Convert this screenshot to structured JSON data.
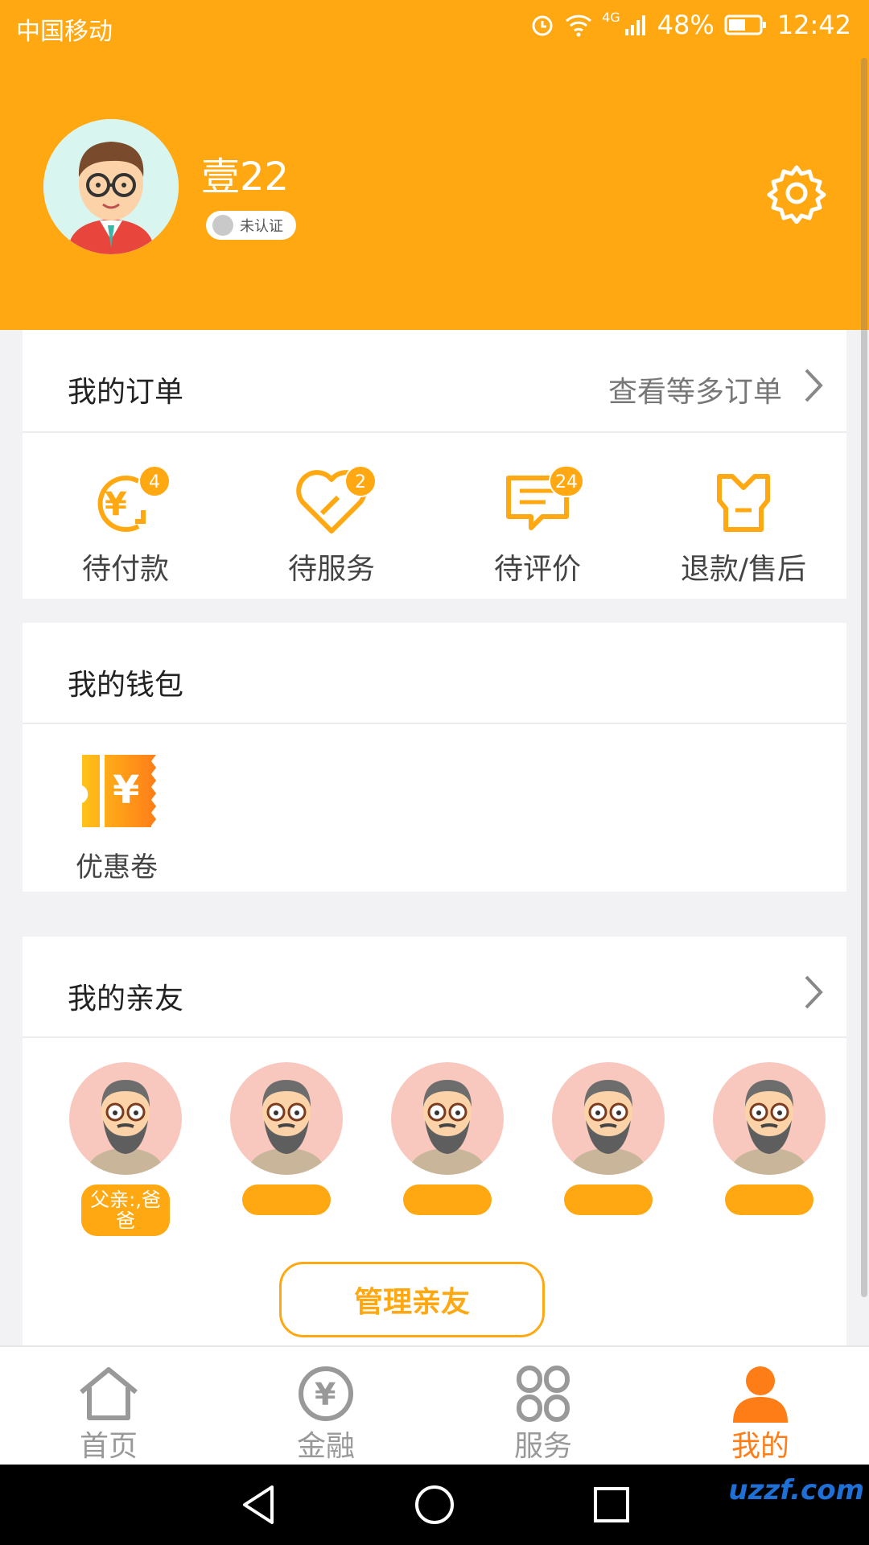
{
  "status_bar": {
    "carrier": "中国移动",
    "battery": "48%",
    "time": "12:42",
    "network": "4G"
  },
  "profile": {
    "username": "壹22",
    "cert_status": "未认证"
  },
  "orders": {
    "title": "我的订单",
    "more": "查看等多订单",
    "items": [
      {
        "label": "待付款",
        "badge": "4",
        "icon": "payment-icon"
      },
      {
        "label": "待服务",
        "badge": "2",
        "icon": "heart-service-icon"
      },
      {
        "label": "待评价",
        "badge": "24",
        "icon": "comment-icon"
      },
      {
        "label": "退款/售后",
        "badge": "",
        "icon": "after-sale-icon"
      }
    ]
  },
  "wallet": {
    "title": "我的钱包",
    "coupon_label": "优惠卷"
  },
  "friends": {
    "title": "我的亲友",
    "items": [
      {
        "label": "父亲:,爸爸"
      },
      {
        "label": ""
      },
      {
        "label": ""
      },
      {
        "label": ""
      },
      {
        "label": ""
      }
    ],
    "manage_button": "管理亲友"
  },
  "tabs": [
    {
      "label": "首页",
      "icon": "home-icon",
      "active": false
    },
    {
      "label": "金融",
      "icon": "yuan-icon",
      "active": false
    },
    {
      "label": "服务",
      "icon": "grid-icon",
      "active": false
    },
    {
      "label": "我的",
      "icon": "person-icon",
      "active": true
    }
  ],
  "watermark": "uzzf.com",
  "colors": {
    "accent": "#ffa812",
    "active_tab": "#ff7d17"
  }
}
